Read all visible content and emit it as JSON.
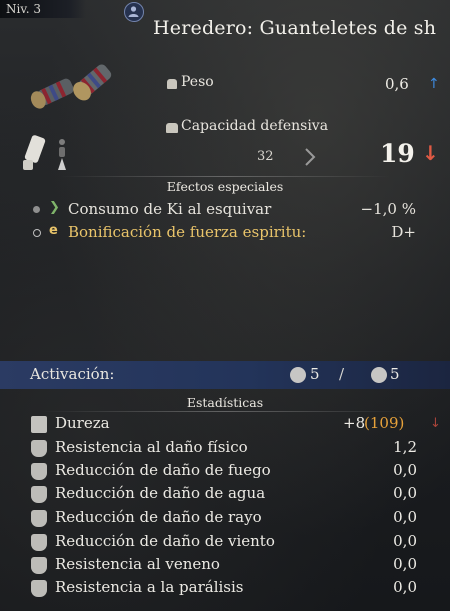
{
  "header": {
    "level": "Niv. 3",
    "title": "Heredero: Guanteletes de sh"
  },
  "stats_top": {
    "weight_label": "Peso",
    "weight_value": "0,6",
    "weight_arrow": "↑",
    "defense_label": "Capacidad defensiva",
    "defense_old": "32",
    "defense_new": "19",
    "defense_arrow": "↓"
  },
  "special_effects": {
    "title": "Efectos especiales",
    "items": [
      {
        "label": "Consumo de Ki al esquivar",
        "value": "−1,0 %",
        "color": "#e6e3dc",
        "bullet_color": "#8f8f8f"
      },
      {
        "label": "Bonificación de fuerza espiritu:",
        "value": "D+",
        "color": "#e9c46a",
        "bullet_color": "#bfbfbf"
      }
    ]
  },
  "activation": {
    "label": "Activación:",
    "count_a": "5",
    "separator": "/",
    "count_b": "5"
  },
  "statistics": {
    "title": "Estadísticas",
    "durability_label": "Dureza",
    "durability_value": "+8",
    "durability_paren": "(109)",
    "durability_arrow": "↓",
    "rows": [
      {
        "label": "Resistencia al daño físico",
        "value": "1,2"
      },
      {
        "label": "Reducción de daño de fuego",
        "value": "0,0"
      },
      {
        "label": "Reducción de daño de agua",
        "value": "0,0"
      },
      {
        "label": "Reducción de daño de rayo",
        "value": "0,0"
      },
      {
        "label": "Reducción de daño de viento",
        "value": "0,0"
      },
      {
        "label": "Resistencia al veneno",
        "value": "0,0"
      },
      {
        "label": "Resistencia a la parálisis",
        "value": "0,0"
      }
    ]
  },
  "colors": {
    "highlight_text": "#e9c46a",
    "increase": "#3d8be0",
    "decrease": "#e05a44",
    "activation_bar": "#2b3b63"
  }
}
